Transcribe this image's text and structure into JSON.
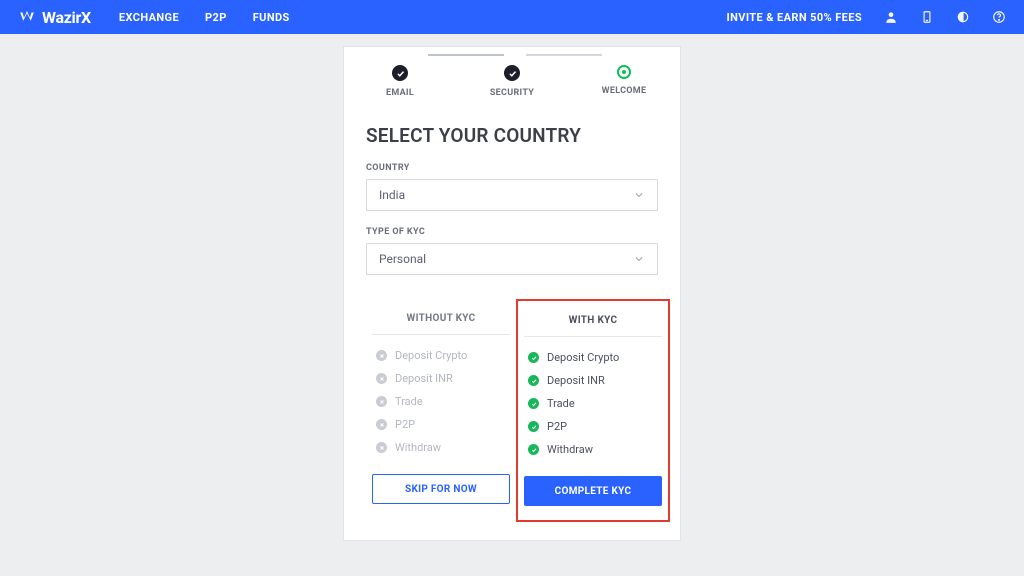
{
  "brand": "WazirX",
  "nav": {
    "links": [
      "EXCHANGE",
      "P2P",
      "FUNDS"
    ],
    "invite": "INVITE & EARN 50% FEES"
  },
  "stepper": {
    "steps": [
      {
        "label": "EMAIL",
        "state": "done"
      },
      {
        "label": "SECURITY",
        "state": "done"
      },
      {
        "label": "WELCOME",
        "state": "current"
      }
    ]
  },
  "form": {
    "title": "SELECT YOUR COUNTRY",
    "country_label": "COUNTRY",
    "country_value": "India",
    "kyc_type_label": "TYPE OF KYC",
    "kyc_type_value": "Personal"
  },
  "kyc": {
    "without_header": "WITHOUT KYC",
    "with_header": "WITH KYC",
    "features": [
      "Deposit Crypto",
      "Deposit INR",
      "Trade",
      "P2P",
      "Withdraw"
    ],
    "skip_label": "SKIP FOR NOW",
    "complete_label": "COMPLETE KYC"
  }
}
